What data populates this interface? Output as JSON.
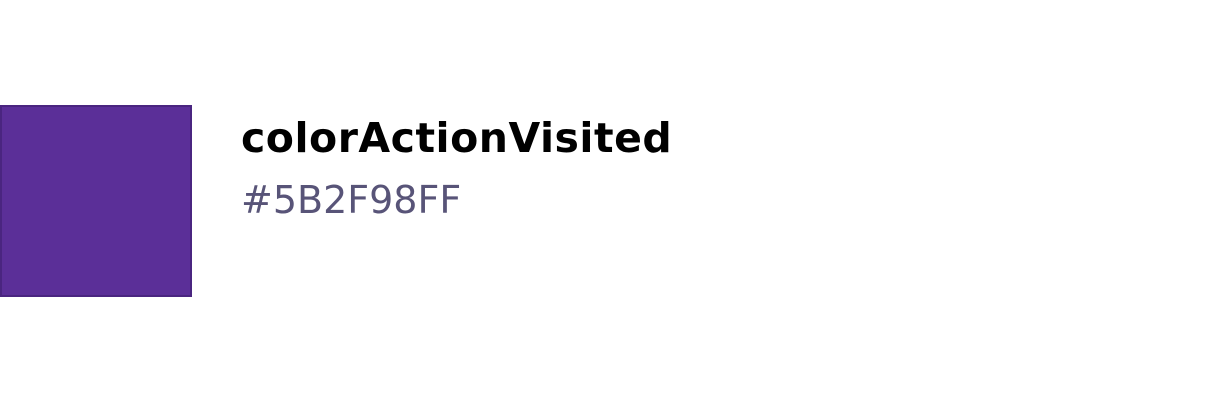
{
  "token": {
    "name": "colorActionVisited",
    "value": "#5B2F98FF",
    "swatch_color": "#5B2F98",
    "swatch_border_color": "#4A2580"
  },
  "colors": {
    "name_text": "#000000",
    "value_text": "#585478",
    "background": "#FFFFFF"
  }
}
